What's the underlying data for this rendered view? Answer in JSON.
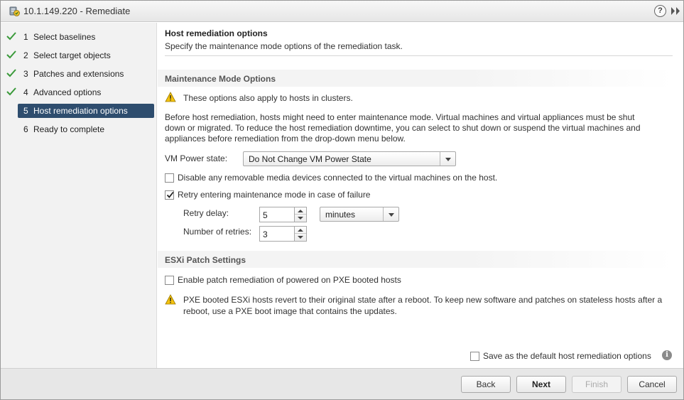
{
  "window": {
    "title": "10.1.149.220 - Remediate",
    "help_label": "?"
  },
  "steps": [
    {
      "num": "1",
      "label": "Select baselines",
      "done": true
    },
    {
      "num": "2",
      "label": "Select target objects",
      "done": true
    },
    {
      "num": "3",
      "label": "Patches and extensions",
      "done": true
    },
    {
      "num": "4",
      "label": "Advanced options",
      "done": true
    },
    {
      "num": "5",
      "label": "Host remediation options",
      "done": false,
      "active": true
    },
    {
      "num": "6",
      "label": "Ready to complete",
      "done": false
    }
  ],
  "header": {
    "title": "Host remediation options",
    "subtitle": "Specify the maintenance mode options of the remediation task."
  },
  "maintenance": {
    "section_title": "Maintenance Mode Options",
    "cluster_warning": "These options also apply to hosts in clusters.",
    "description_line1": "Before host remediation, hosts might need to enter maintenance mode. Virtual machines and virtual appliances must be shut",
    "description_line2": "down or migrated. To reduce the host remediation downtime, you can select to shut down or suspend the virtual machines and",
    "description_line3": "appliances before remediation from the drop-down menu below.",
    "vm_power_label": "VM Power state:",
    "vm_power_value": "Do Not Change VM Power State",
    "disable_media_label": "Disable any removable media devices connected to the virtual machines on the host.",
    "disable_media_checked": false,
    "retry_label": "Retry entering maintenance mode in case of failure",
    "retry_checked": true,
    "retry_delay_label": "Retry delay:",
    "retry_delay_value": "5",
    "retry_delay_unit": "minutes",
    "retries_label": "Number of retries:",
    "retries_value": "3"
  },
  "esxi": {
    "section_title": "ESXi Patch Settings",
    "pxe_label": "Enable patch remediation of powered on PXE booted hosts",
    "pxe_checked": false,
    "pxe_warning_line1": "PXE booted ESXi hosts revert to their original state after a reboot. To keep new software and patches on stateless hosts after a",
    "pxe_warning_line2": "reboot, use a PXE boot image that contains the updates."
  },
  "save_default": {
    "label": "Save as the default host remediation options",
    "checked": false,
    "info_glyph": "i"
  },
  "footer": {
    "back": "Back",
    "next": "Next",
    "finish": "Finish",
    "cancel": "Cancel"
  },
  "colors": {
    "active_step_bg": "#2e4d6e",
    "check_green": "#3a9a3a",
    "warning_yellow": "#f4c20d"
  }
}
